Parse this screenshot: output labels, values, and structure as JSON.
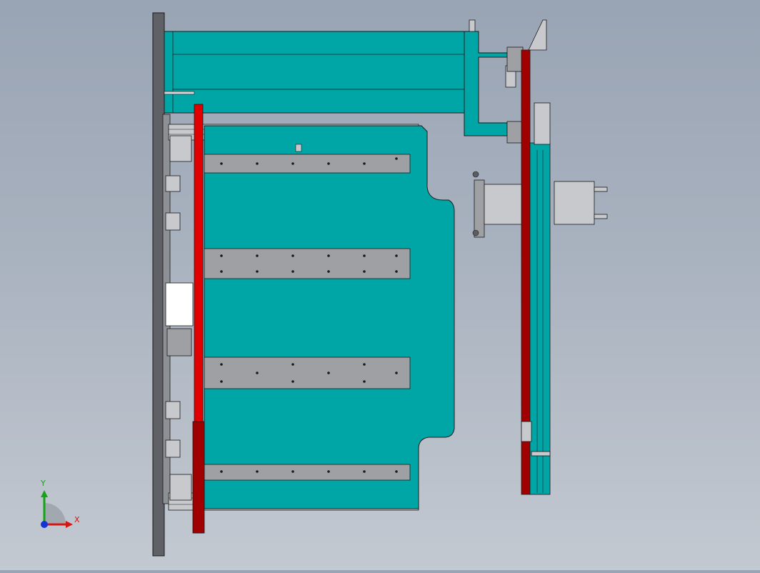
{
  "viewport": {
    "background_top": "#99a4b4",
    "background_bottom": "#c3c9d1"
  },
  "colors": {
    "teal": "#00a6a6",
    "teal_dark": "#008a8a",
    "red": "#e00000",
    "dark_red": "#a00000",
    "steel": "#9ea0a4",
    "steel_light": "#c8c9cc",
    "steel_dark": "#5c5e63",
    "outline": "#1a1a1a"
  },
  "triad": {
    "x_label": "X",
    "y_label": "Y",
    "x_color": "#d81414",
    "y_color": "#17a317",
    "z_color": "#1432d8"
  },
  "components": [
    "base-plate",
    "motor-housing",
    "red-vertical-plate",
    "teal-carrier-panel",
    "gray-rails",
    "right-column",
    "gripper-cylinder",
    "coordinate-triad"
  ]
}
